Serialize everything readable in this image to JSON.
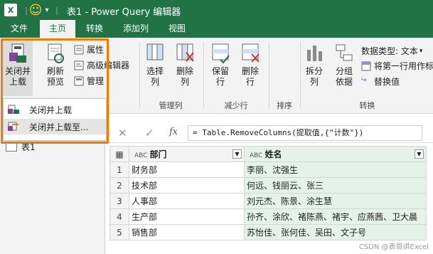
{
  "title": "表1 - Power Query 编辑器",
  "titlebar": {
    "excel_icon": "X",
    "smiley": "☺",
    "arrow": "▾",
    "sep": "|"
  },
  "tabs": [
    "文件",
    "主页",
    "转换",
    "添加列",
    "视图"
  ],
  "ribbon": {
    "close_upload": "关闭并\n上载",
    "refresh_preview": "刷新\n预览",
    "properties": "属性",
    "advanced_editor": "高级编辑器",
    "manage": "管理",
    "select_columns": "选择\n列",
    "remove_columns": "删除\n列",
    "keep_rows": "保留\n行",
    "remove_rows": "删除\n行",
    "split_column": "拆分\n列",
    "group_by": "分组\n依据",
    "data_type": "数据类型: 文本",
    "first_row_header": "将第一行用作标",
    "replace_values": "替换值",
    "group_manage_columns": "管理列",
    "group_reduce_rows": "减少行",
    "group_sort": "排序",
    "group_transform": "转换"
  },
  "menu": {
    "item1": "关闭并上载",
    "item2": "关闭并上载至..."
  },
  "formula": {
    "cancel": "✕",
    "confirm": "✓",
    "fx": "fx",
    "text": "= Table.RemoveColumns(提取值,{\"计数\"})"
  },
  "query_item": "表1",
  "grid": {
    "type_label": "ABC",
    "headers": [
      "部门",
      "姓名"
    ],
    "rows": [
      {
        "n": "1",
        "dept": "财务部",
        "name": "李丽、沈强生"
      },
      {
        "n": "2",
        "dept": "技术部",
        "name": "何远、钱丽云、张三"
      },
      {
        "n": "3",
        "dept": "人事部",
        "name": "刘元杰、陈景、涂生慧"
      },
      {
        "n": "4",
        "dept": "生产部",
        "name": "孙齐、涂欣、褚陈燕、褚宇、应燕茜、卫大晨"
      },
      {
        "n": "5",
        "dept": "销售部",
        "name": "苏怡佳、张何佳、吴田、文子号"
      }
    ]
  },
  "watermark": "CSDN @表哥讲Excel",
  "colors": {
    "brand": "#217346",
    "highlight": "#f07d00"
  }
}
